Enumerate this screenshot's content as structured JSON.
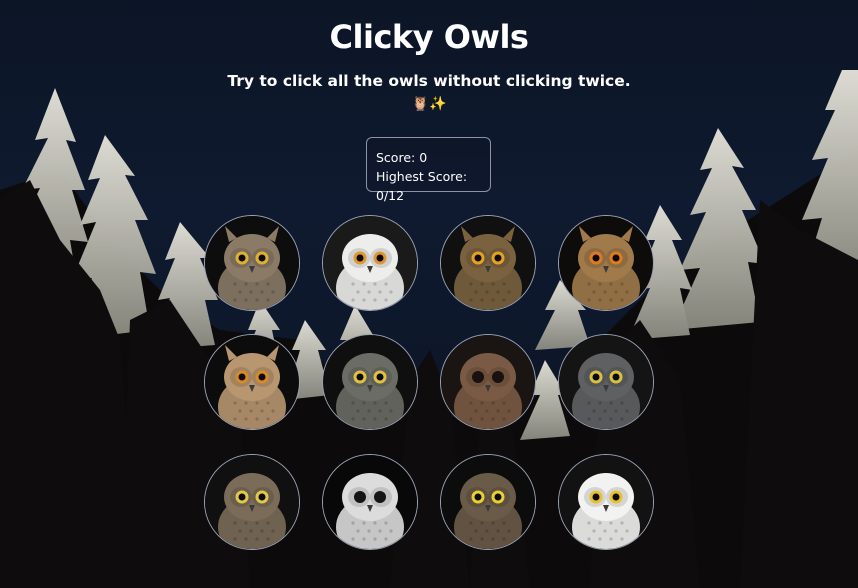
{
  "title": "Clicky Owls",
  "subtitle": "Try to click all the owls without clicking twice.",
  "emoji": "🦉✨",
  "score": {
    "score_label": "Score: 0",
    "highest_label": "Highest Score: 0/12"
  },
  "owls": [
    {
      "icon": "great-horned-owl",
      "bg": "#0d0d0d",
      "face": "#8a7a66",
      "eye": "#e0b030",
      "eye_style": "yellow"
    },
    {
      "icon": "snowy-owl",
      "bg": "#1a1a1a",
      "face": "#ededeb",
      "eye": "#e09630",
      "eye_style": "orange"
    },
    {
      "icon": "long-eared-owl",
      "bg": "#101010",
      "face": "#7a6240",
      "eye": "#e8a020",
      "eye_style": "yellow"
    },
    {
      "icon": "eurasian-eagle-owl",
      "bg": "#0e0c0a",
      "face": "#a07a4a",
      "eye": "#e07a20",
      "eye_style": "orange"
    },
    {
      "icon": "eagle-owl",
      "bg": "#0c0c0c",
      "face": "#b89670",
      "eye": "#d88a28",
      "eye_style": "orange"
    },
    {
      "icon": "northern-hawk-owl",
      "bg": "#0f0f0f",
      "face": "#6c6c66",
      "eye": "#e0c040",
      "eye_style": "yellow"
    },
    {
      "icon": "tawny-owl",
      "bg": "#1a1412",
      "face": "#7a5a44",
      "eye": "#1a1010",
      "eye_style": "dark"
    },
    {
      "icon": "great-grey-owl",
      "bg": "#141414",
      "face": "#5e6062",
      "eye": "#d8c040",
      "eye_style": "yellow"
    },
    {
      "icon": "little-owl",
      "bg": "#101010",
      "face": "#7a6c58",
      "eye": "#e0c848",
      "eye_style": "yellow"
    },
    {
      "icon": "barn-owl",
      "bg": "#080808",
      "face": "#dcdcdc",
      "eye": "#151515",
      "eye_style": "dark"
    },
    {
      "icon": "boreal-owl",
      "bg": "#0c0c0c",
      "face": "#6a5a48",
      "eye": "#e8d030",
      "eye_style": "yellow"
    },
    {
      "icon": "white-snowy-owl",
      "bg": "#121212",
      "face": "#f2f2f0",
      "eye": "#e8c030",
      "eye_style": "yellow"
    }
  ]
}
